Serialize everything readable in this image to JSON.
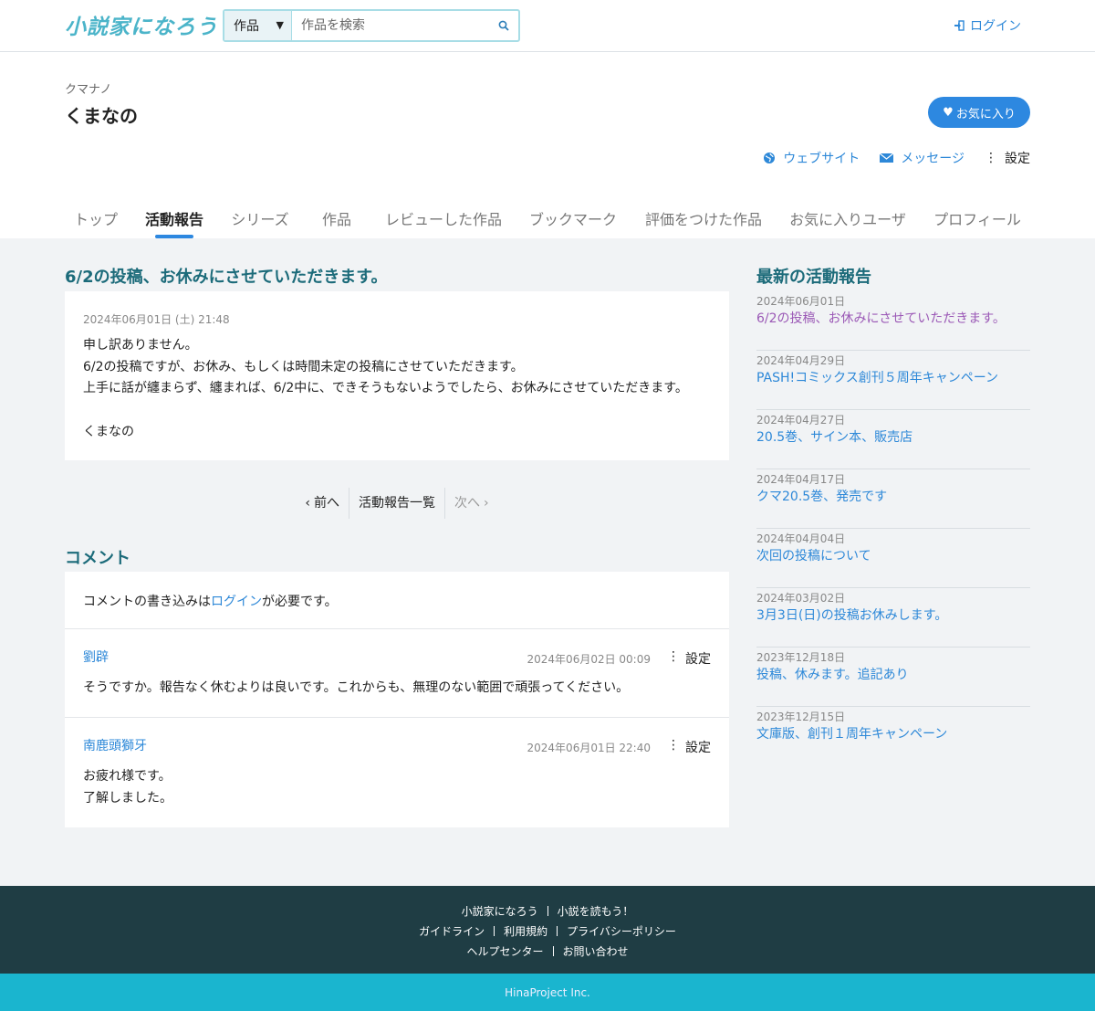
{
  "header": {
    "logo_text": "小説家になろう",
    "search_category": "作品",
    "search_placeholder": "作品を検索",
    "login_label": "ログイン"
  },
  "profile": {
    "kana": "クマナノ",
    "name": "くまなの",
    "favorite_label": "お気に入り",
    "actions": {
      "website": "ウェブサイト",
      "message": "メッセージ",
      "settings": "設定"
    }
  },
  "tabs": [
    {
      "label": "トップ"
    },
    {
      "label": "活動報告"
    },
    {
      "label": "シリーズ"
    },
    {
      "label": "作品"
    },
    {
      "label": "レビューした作品"
    },
    {
      "label": "ブックマーク"
    },
    {
      "label": "評価をつけた作品"
    },
    {
      "label": "お気に入りユーザ"
    },
    {
      "label": "プロフィール"
    }
  ],
  "active_tab": "活動報告",
  "post": {
    "title": "6/2の投稿、お休みにさせていただきます。",
    "date": "2024年06月01日 (土) 21:48",
    "lines": [
      "申し訳ありません。",
      "6/2の投稿ですが、お休み、もしくは時間未定の投稿にさせていただきます。",
      "上手に話が纏まらず、纏まれば、6/2中に、できそうもないようでしたら、お休みにさせていただきます。",
      "",
      "くまなの"
    ]
  },
  "pager": {
    "prev": "前へ",
    "list": "活動報告一覧",
    "next": "次へ"
  },
  "comments": {
    "heading": "コメント",
    "login_prefix": "コメントの書き込みは",
    "login_link": "ログイン",
    "login_suffix": "が必要です。",
    "settings_label": "設定",
    "items": [
      {
        "author": "劉辟",
        "date": "2024年06月02日 00:09",
        "lines": [
          "そうですか。報告なく休むよりは良いです。これからも、無理のない範囲で頑張ってください。"
        ]
      },
      {
        "author": "南鹿頭獅牙",
        "date": "2024年06月01日 22:40",
        "lines": [
          "お疲れ様です。",
          "了解しました。"
        ]
      }
    ]
  },
  "sidebar": {
    "heading": "最新の活動報告",
    "items": [
      {
        "date": "2024年06月01日",
        "title": "6/2の投稿、お休みにさせていただきます。",
        "visited": true
      },
      {
        "date": "2024年04月29日",
        "title": "PASH!コミックス創刊５周年キャンペーン",
        "visited": false
      },
      {
        "date": "2024年04月27日",
        "title": "20.5巻、サイン本、販売店",
        "visited": false
      },
      {
        "date": "2024年04月17日",
        "title": "クマ20.5巻、発売です",
        "visited": false
      },
      {
        "date": "2024年04月04日",
        "title": "次回の投稿について",
        "visited": false
      },
      {
        "date": "2024年03月02日",
        "title": "3月3日(日)の投稿お休みします。",
        "visited": false
      },
      {
        "date": "2023年12月18日",
        "title": "投稿、休みます。追記あり",
        "visited": false
      },
      {
        "date": "2023年12月15日",
        "title": "文庫版、創刊１周年キャンペーン",
        "visited": false
      }
    ]
  },
  "footer": {
    "rows": [
      [
        "小説家になろう",
        "小説を読もう！"
      ],
      [
        "ガイドライン",
        "利用規約",
        "プライバシーポリシー"
      ],
      [
        "ヘルプセンター",
        "お問い合わせ"
      ]
    ],
    "copyright": "HinaProject Inc."
  },
  "colors": {
    "accent": "#2d88e0",
    "link": "#2d88d8",
    "heading": "#1c6b7a",
    "visited": "#9b59b6",
    "footer_dark": "#1f3d44",
    "footer_light": "#1ab5cf"
  }
}
